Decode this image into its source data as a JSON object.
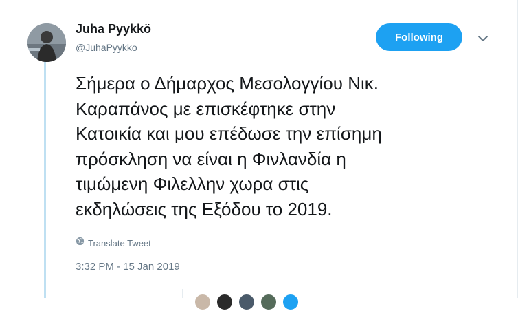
{
  "tweet": {
    "author_name": "Juha Pyykkö",
    "author_handle": "@JuhaPyykko",
    "follow_label": "Following",
    "text": "Σήμερα ο Δήμαρχος Μεσολογγίου Νικ.\nΚαραπάνος με επισκέφτηκε στην\nΚατοικία και μου επέδωσε την επίσημη\nπρόσκληση να είναι η Φινλανδία η\nτιμώμενη Φιλελλην χωρα στις\nεκδηλώσεις της Εξόδου το 2019.",
    "translate_label": "Translate Tweet",
    "timestamp": "3:32 PM - 15 Jan 2019"
  },
  "colors": {
    "accent": "#1da1f2",
    "thread_line": "#bfe0f2",
    "muted_text": "#657786",
    "divider": "#e6ecf0"
  },
  "icons": {
    "caret": "chevron-down-icon",
    "translate": "globe-icon"
  }
}
